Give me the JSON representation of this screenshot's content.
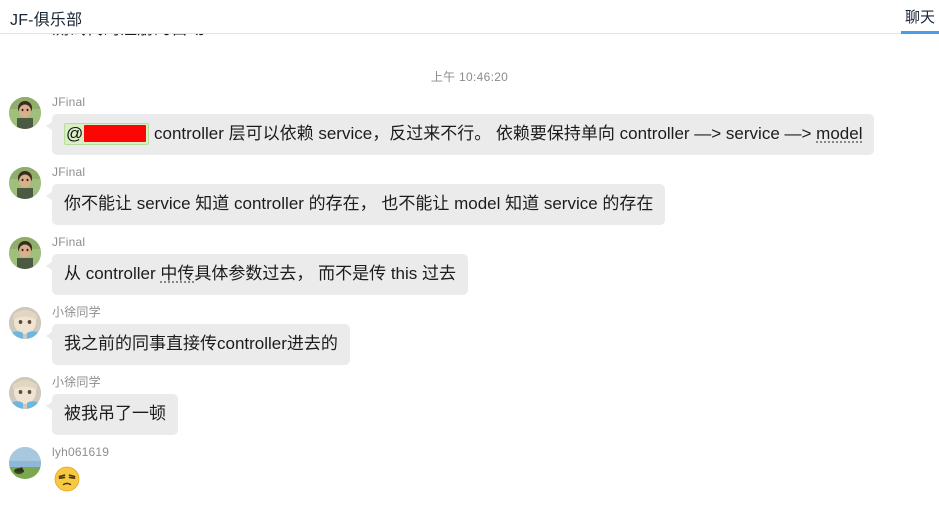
{
  "header": {
    "title": "JF-俱乐部",
    "tabs": [
      {
        "label": "聊天",
        "active": true
      }
    ]
  },
  "chat": {
    "clipped_message_above": "测试代码注册的自动",
    "timestamp": "上午 10:46:20",
    "messages": [
      {
        "author": "JFinal",
        "avatar": "photo-man-green-bg",
        "type": "text-with-mention",
        "mention_at": "@",
        "mention_redacted": true,
        "text_part1": " controller 层可以依赖 service，反过来不行。 依赖要保持单向  controller —> service —> ",
        "text_spell": "model"
      },
      {
        "author": "JFinal",
        "avatar": "photo-man-green-bg",
        "type": "text",
        "text": "你不能让 service 知道 controller 的存在， 也不能让  model 知道 service  的存在"
      },
      {
        "author": "JFinal",
        "avatar": "photo-man-green-bg",
        "type": "text-spellcheck",
        "text_before": "从 controller ",
        "text_spell": "中传",
        "text_after": "具体参数过去， 而不是传  this 过去"
      },
      {
        "author": "小徐同学",
        "avatar": "anime-pale-face",
        "type": "text",
        "text": "我之前的同事直接传controller进去的"
      },
      {
        "author": "小徐同学",
        "avatar": "anime-pale-face",
        "type": "text",
        "text": "被我吊了一顿"
      },
      {
        "author": "lyh061619",
        "avatar": "landscape-scenery",
        "type": "emoji",
        "emoji_name": "persevering-face-emoji"
      }
    ]
  },
  "colors": {
    "bubble_bg": "#ebebeb",
    "mention_bg": "#d9f0c6",
    "redaction": "#fb0505",
    "tab_accent": "#4a9ee8",
    "author_text": "#8e8e8e"
  }
}
